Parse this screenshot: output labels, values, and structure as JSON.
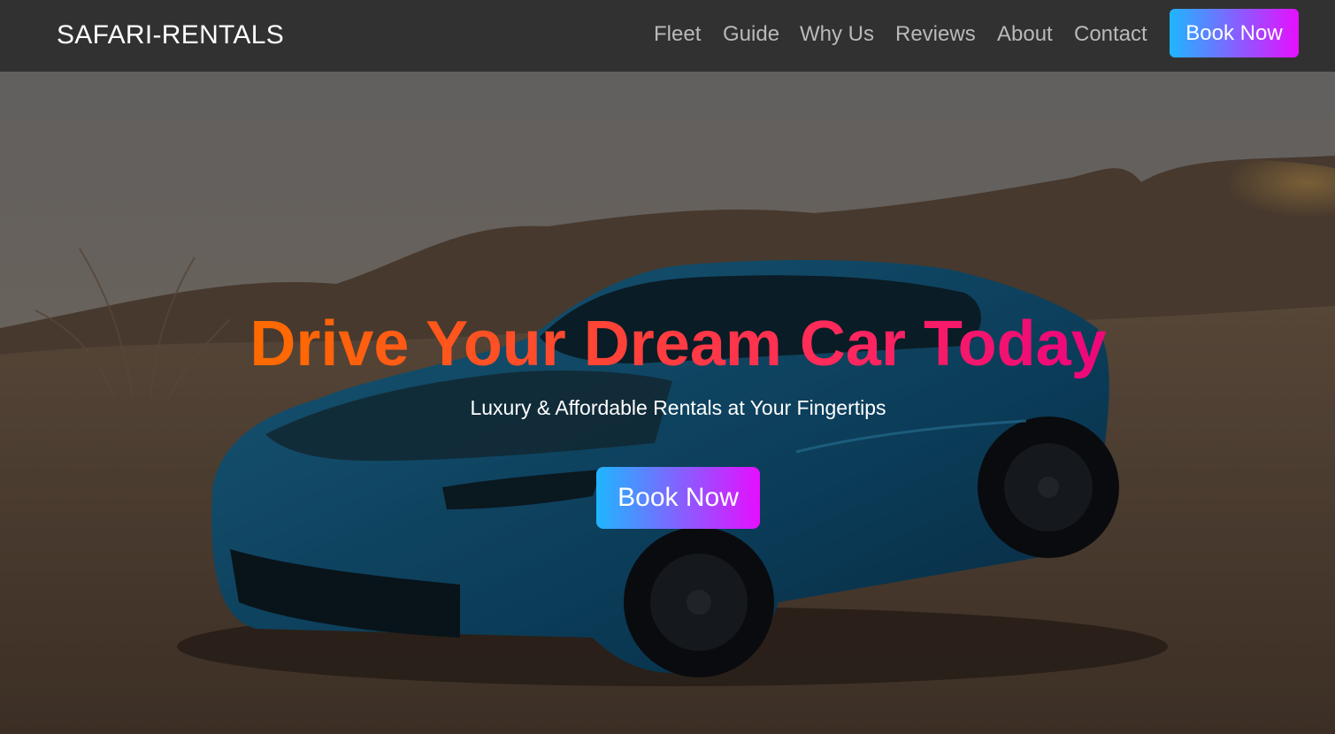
{
  "brand": {
    "name": "SAFARI-RENTALS"
  },
  "nav": {
    "items": [
      {
        "label": "Fleet"
      },
      {
        "label": "Guide"
      },
      {
        "label": "Why Us"
      },
      {
        "label": "Reviews"
      },
      {
        "label": "About"
      },
      {
        "label": "Contact"
      }
    ],
    "cta_label": "Book Now"
  },
  "hero": {
    "title": "Drive Your Dream Car Today",
    "subtitle": "Luxury & Affordable Rentals at Your Fingertips",
    "cta_label": "Book Now"
  },
  "colors": {
    "navbar_bg": "#313131",
    "nav_link": "#b9b9b9",
    "button_gradient_start": "#1fb6ff",
    "button_gradient_end": "#e60fff",
    "title_gradient_start": "#ff6a00",
    "title_gradient_end": "#ee0979"
  }
}
